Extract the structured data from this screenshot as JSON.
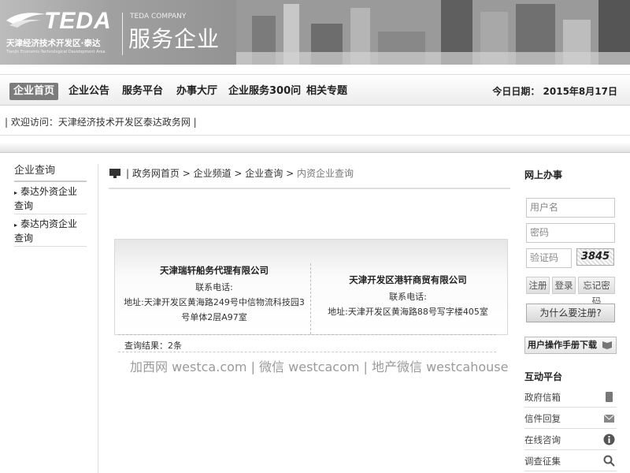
{
  "header": {
    "logo_text": "TEDA",
    "logo_cn": "天津经济技术开发区·泰达",
    "logo_en": "Tianjin Economic-Technological Development Area",
    "company_en": "TEDA COMPANY",
    "company_cn": "服务企业"
  },
  "nav": {
    "items": [
      "企业首页",
      "企业公告",
      "服务平台",
      "办事大厅",
      "企业服务300问",
      "相关专题"
    ],
    "date": "今日日期： 2015年8月17日"
  },
  "welcome": "| 欢迎访问：天津经济技术开发区泰达政务网 |",
  "sidebar": {
    "title": "企业查询",
    "items": [
      "泰达外资企业查询",
      "泰达内资企业查询"
    ]
  },
  "breadcrumb": {
    "sep": " > ",
    "items": [
      "政务网首页",
      "企业频道",
      "企业查询",
      "内资企业查询"
    ]
  },
  "results": {
    "companies": [
      {
        "name": "天津瑞轩船务代理有限公司",
        "phone_label": "联系电话:",
        "address": "地址:天津开发区黄海路249号中信物流科技园3号单体2层A97室"
      },
      {
        "name": "天津开发区港轩商贸有限公司",
        "phone_label": "联系电话:",
        "address": "地址:天津开发区黄海路88号写字楼405室"
      }
    ],
    "count": "查询结果：2条"
  },
  "watermark": "加西网 westca.com | 微信 westcacom | 地产微信 westcahouse",
  "online": {
    "title": "网上办事",
    "username_placeholder": "用户名",
    "password_placeholder": "密码",
    "captcha_placeholder": "验证码",
    "captcha_code": "3845",
    "register": "注册",
    "login": "登录",
    "forgot": "忘记密码",
    "why_register": "为什么要注册?",
    "manual": "用户操作手册下载"
  },
  "interaction": {
    "title": "互动平台",
    "items": [
      "政府信箱",
      "信件回复",
      "在线咨询",
      "调查征集"
    ]
  }
}
